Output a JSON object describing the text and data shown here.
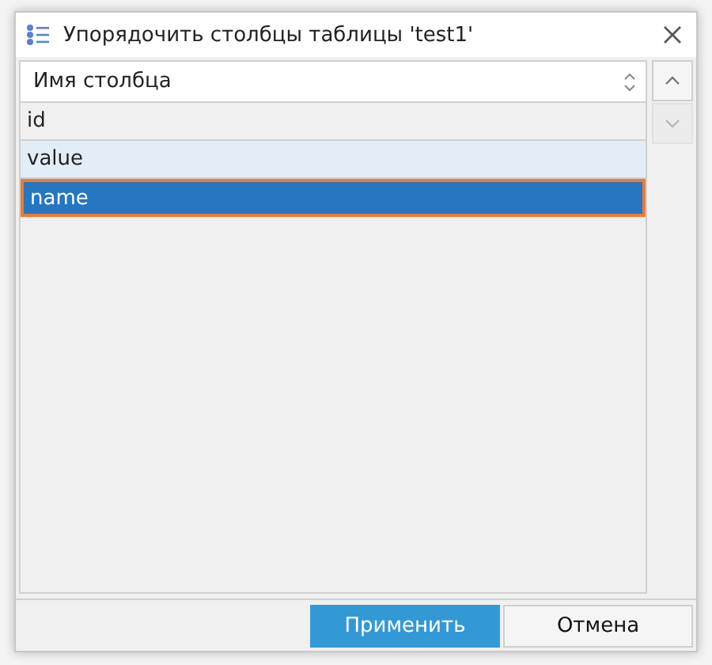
{
  "window": {
    "title": "Упорядочить столбцы таблицы 'test1'"
  },
  "table": {
    "header": "Имя столбца",
    "rows": [
      {
        "label": "id",
        "selected": false,
        "hovered": false
      },
      {
        "label": "value",
        "selected": false,
        "hovered": true
      },
      {
        "label": "name",
        "selected": true,
        "hovered": false
      }
    ]
  },
  "move_buttons": [
    {
      "kind": "up",
      "disabled": false
    },
    {
      "kind": "down",
      "disabled": true
    }
  ],
  "buttons": [
    {
      "label": "Применить",
      "kind": "primary"
    },
    {
      "label": "Отмена",
      "kind": "secondary"
    }
  ]
}
